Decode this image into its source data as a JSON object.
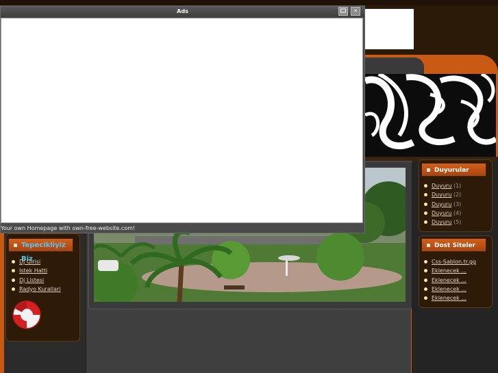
{
  "ads_popup": {
    "title": "Ads",
    "footer": "Your own Homepage with own-free-website.com!",
    "minimize_icon": "window-icon",
    "close_icon": "close-icon",
    "close_glyph": "✕"
  },
  "left_box": {
    "title": "Tepecikliyiz Biz",
    "items": [
      {
        "label": "Dj Girisi"
      },
      {
        "label": "Istek Hatti"
      },
      {
        "label": "Dj Listesi"
      },
      {
        "label": "Radyo Kurallari"
      }
    ]
  },
  "announcements": {
    "title": "Duyurular",
    "items": [
      {
        "label": "Duyuru",
        "count": "(1)"
      },
      {
        "label": "Duyuru",
        "count": "(2)"
      },
      {
        "label": "Duyuru",
        "count": "(3)"
      },
      {
        "label": "Duyuru",
        "count": "(4)"
      },
      {
        "label": "Duyuru",
        "count": "(5)"
      }
    ]
  },
  "friend_sites": {
    "title": "Dost Siteler",
    "items": [
      {
        "label": "Css-Sablon.tr.gg"
      },
      {
        "label": "Eklenecek ..."
      },
      {
        "label": "Eklenecek ..."
      },
      {
        "label": "Eklenecek ..."
      },
      {
        "label": "Eklenecek ..."
      }
    ]
  },
  "colors": {
    "accent_orange": "#c85a14",
    "title_blue": "#57c4f2",
    "background": "#2c1a08"
  }
}
